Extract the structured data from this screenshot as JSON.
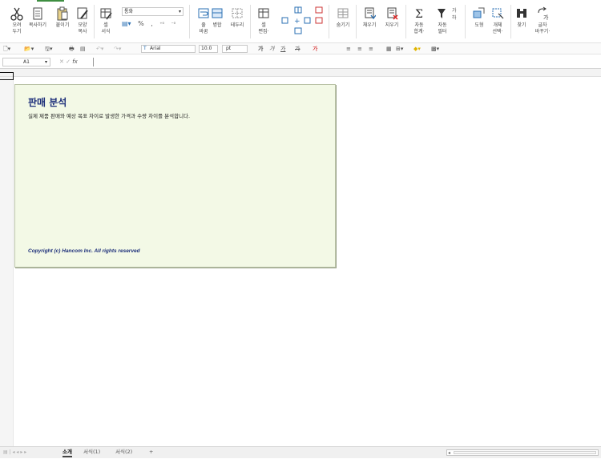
{
  "ribbon": {
    "cut_label": "오려\n두기",
    "copy_label": "복사하기",
    "paste_label": "붙이기",
    "format_copy_label": "모양\n복사",
    "cell_style_label": "셀\n서식",
    "number_format_value": "통화",
    "percent_label": "%",
    "comma_label": ",",
    "dec_increase_label": ".00→.0",
    "dec_decrease_label": ".0→.00",
    "fill_label": "줄\n바꿈",
    "merge_label": "병합",
    "border_label": "테두리",
    "cell_edit_label": "셀\n편집·",
    "insert_delete_label": "",
    "hide_label": "숨기기",
    "sort_asc_label": "채우기",
    "sort_desc_label": "지우기",
    "autosum_label": "자동\n합계·",
    "autofilter_label": "자동\n필터",
    "shape_label": "도형",
    "object_select_label": "개체\n선택·",
    "find_label": "찾기",
    "replace_label": "글자\n바꾸기·"
  },
  "toolbar2": {
    "font_name": "Arial",
    "font_size": "10.0",
    "unit": "pt",
    "bold": "가",
    "italic": "가",
    "underline": "가",
    "strike": "가",
    "color_text": "가"
  },
  "formula_bar": {
    "cell_ref": "A1",
    "fx_label": "fx",
    "formula_value": ""
  },
  "panel": {
    "title": "판매 분석",
    "description": "실제 제품 판매와 예상 목표 차이로 발생한 가격과 수량 차이를 분석합니다.",
    "copyright": "Copyright (c) Hancom Inc. All rights reserved"
  },
  "sheet_tabs": {
    "tabs": [
      "소개",
      "서식(1)",
      "서식(2)"
    ],
    "add_label": "+"
  },
  "colors": {
    "panel_bg": "#f3f9e6",
    "title_color": "#1d2f7a",
    "accent": "#3e8e41"
  }
}
